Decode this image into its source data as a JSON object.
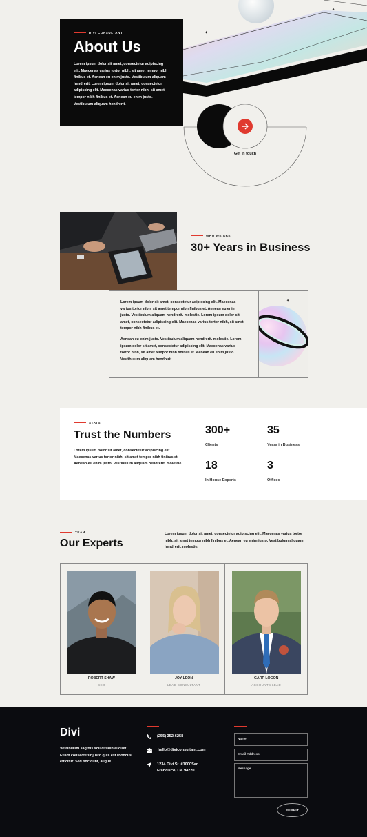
{
  "hero": {
    "eyebrow": "Divi Consultant",
    "title": "About Us",
    "text": "Lorem ipsum dolor sit amet, consectetur adipiscing elit. Maecenas varius tortor nibh, sit amet tempor nibh finibus et. Aenean eu enim justo. Vestibulum aliquam hendrerit. Lorem ipsum dolor sit amet, consectetur adipiscing elit. Maecenas varius tortor nibh, sit amet tempor nibh finibus et. Aenean eu enim justo. Vestibulum aliquam hendrerit.",
    "cta_label": "Get in touch"
  },
  "years": {
    "eyebrow": "Who we are",
    "title": "30+ Years in Business",
    "paragraph1": "Lorem ipsum dolor sit amet, consectetur adipiscing elit. Maecenas varius tortor nibh, sit amet tempor nibh finibus et. Aenean eu enim justo. Vestibulum aliquam hendrerit. molestie. Lorem ipsum dolor sit amet, consectetur adipiscing elit. Maecenas varius tortor nibh, sit amet tempor nibh finibus et.",
    "paragraph2": "Aenean eu enim justo. Vestibulum aliquam hendrerit. molestie. Lorem ipsum dolor sit amet, consectetur adipiscing elit. Maecenas varius tortor nibh, sit amet tempor nibh finibus et. Aenean eu enim justo. Vestibulum aliquam hendrerit."
  },
  "stats": {
    "eyebrow": "Stats",
    "title": "Trust the Numbers",
    "text": "Lorem ipsum dolor sit amet, consectetur adipiscing elit. Maecenas varius tortor nibh, sit amet tempor nibh finibus et. Aenean eu enim justo. Vestibulum aliquam hendrerit. molestie.",
    "items": [
      {
        "number": "300+",
        "label": "Clients"
      },
      {
        "number": "35",
        "label": "Years in Business"
      },
      {
        "number": "18",
        "label": "In House Experts"
      },
      {
        "number": "3",
        "label": "Offices"
      }
    ]
  },
  "experts": {
    "eyebrow": "Team",
    "title": "Our Experts",
    "text": "Lorem ipsum dolor sit amet, consectetur adipiscing elit. Maecenas varius tortor nibh, sit amet tempor nibh finibus et. Aenean eu enim justo. Vestibulum aliquam hendrerit. molestie.",
    "members": [
      {
        "name": "ROBERT SHAW",
        "role": "CEO"
      },
      {
        "name": "JOY LEON",
        "role": "LEAD CONSULTANT"
      },
      {
        "name": "GARP LOGON",
        "role": "ACCOUNTS LEAD"
      }
    ]
  },
  "footer": {
    "logo": "Divi",
    "text": "Vestibulum sagittis sollicitudin aliquet. Etiam consectetur justo quis est rhoncus efficitur. Sed tincidunt, augue",
    "phone": "(255) 352-6258",
    "email": "hello@diviconsultant.com",
    "address": "1234 Divi St. #1000San Francisco, CA 94220",
    "form": {
      "name_placeholder": "Name",
      "email_placeholder": "Email Address",
      "message_placeholder": "Message",
      "submit_label": "SUBMIT"
    }
  },
  "colors": {
    "accent": "#e03a2f",
    "dark": "#0b0b0b",
    "background": "#f1f0ec"
  }
}
